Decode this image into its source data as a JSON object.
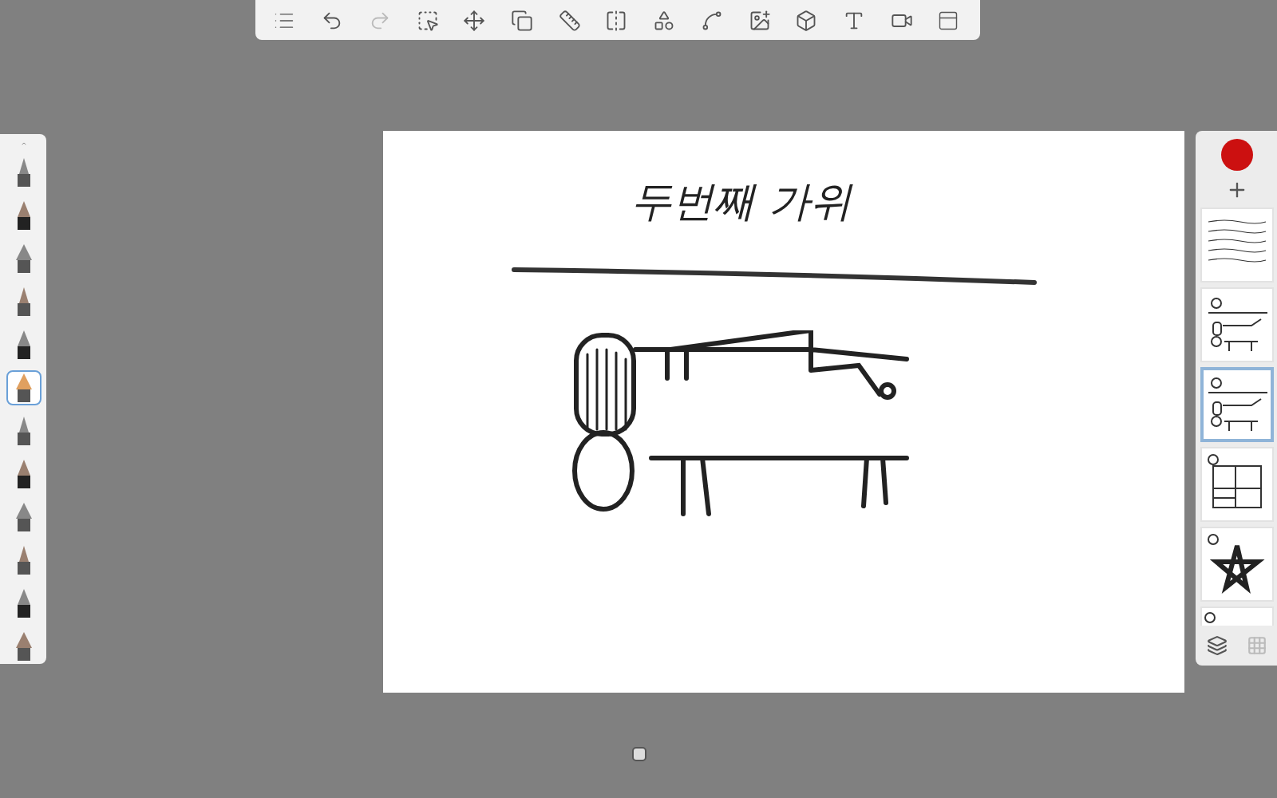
{
  "canvas": {
    "title": "두번째 가위"
  },
  "color_swatch": {
    "color": "#cc1010"
  },
  "brushes": [
    {
      "selected": false
    },
    {
      "selected": false
    },
    {
      "selected": false
    },
    {
      "selected": false
    },
    {
      "selected": false
    },
    {
      "selected": true
    },
    {
      "selected": false
    },
    {
      "selected": false
    },
    {
      "selected": false
    },
    {
      "selected": false
    },
    {
      "selected": false
    },
    {
      "selected": false
    }
  ],
  "layers": [
    {
      "kind": "notes",
      "selected": false
    },
    {
      "kind": "bench",
      "selected": false
    },
    {
      "kind": "bench",
      "selected": true
    },
    {
      "kind": "plan",
      "selected": false
    },
    {
      "kind": "star",
      "selected": false
    },
    {
      "kind": "blank",
      "selected": false
    }
  ]
}
